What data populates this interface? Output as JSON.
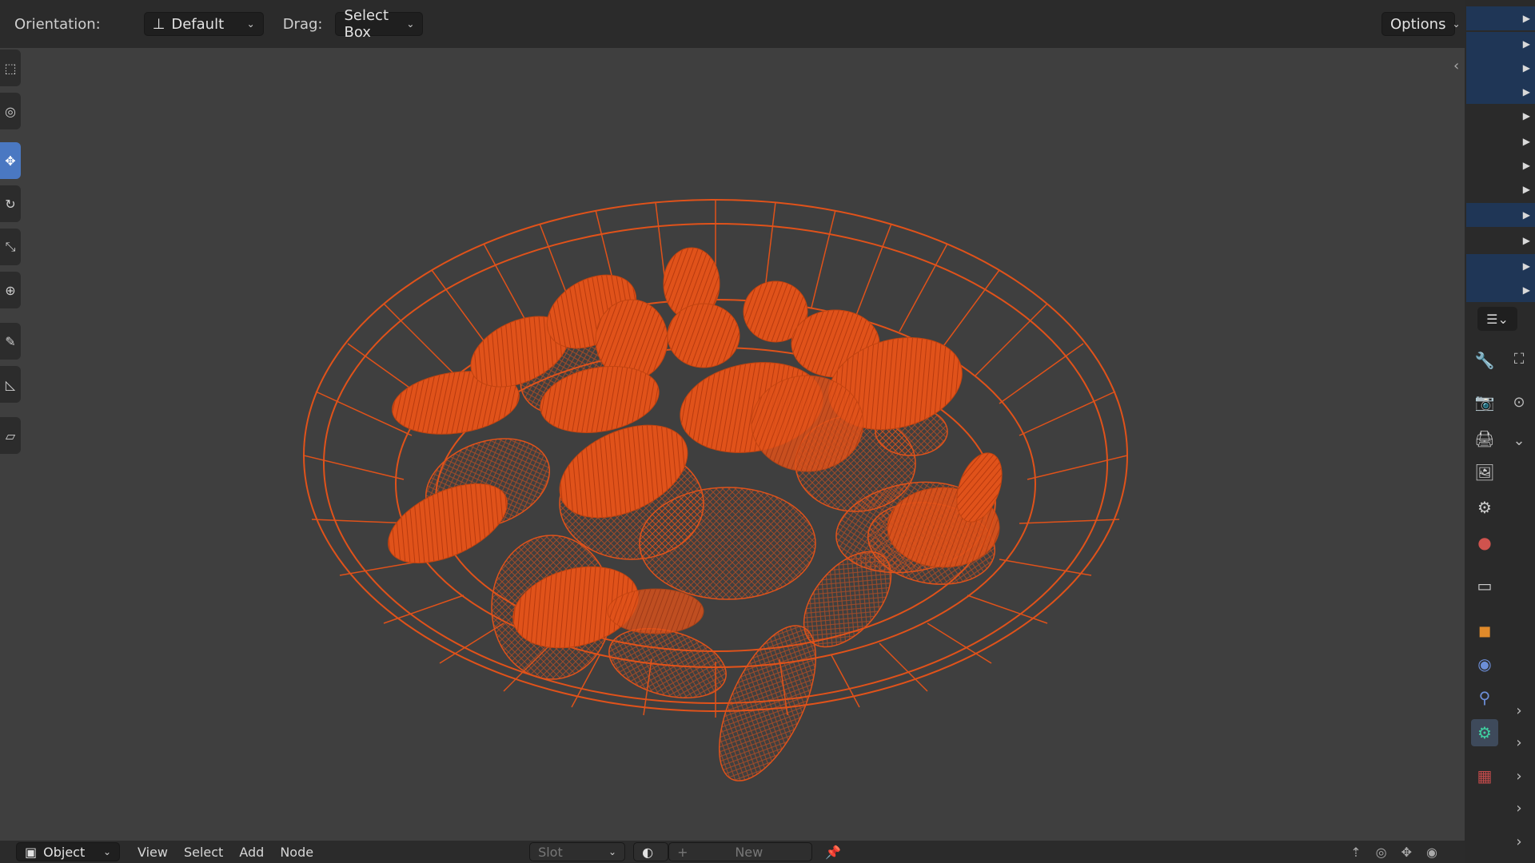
{
  "header": {
    "orientation_label": "Orientation:",
    "orientation_value": "Default",
    "drag_label": "Drag:",
    "drag_value": "Select Box",
    "options_label": "Options"
  },
  "toolbar": {
    "tools": [
      {
        "name": "select-box-tool-icon",
        "glyph": "⬚"
      },
      {
        "name": "cursor-tool-icon",
        "glyph": "◎"
      },
      {
        "name": "move-tool-icon",
        "glyph": "✥"
      },
      {
        "name": "rotate-tool-icon",
        "glyph": "↻"
      },
      {
        "name": "scale-tool-icon",
        "glyph": "⤡"
      },
      {
        "name": "transform-tool-icon",
        "glyph": "⊕"
      },
      {
        "name": "annotate-tool-icon",
        "glyph": "✎"
      },
      {
        "name": "measure-tool-icon",
        "glyph": "📐"
      },
      {
        "name": "add-cube-tool-icon",
        "glyph": "▱"
      }
    ]
  },
  "bottom": {
    "mode": "Object",
    "menus": [
      "View",
      "Select",
      "Add",
      "Node"
    ],
    "slot_label": "Slot",
    "new_label": "New"
  },
  "icons": {
    "tool_settings": "wrench-icon",
    "render": "render-icon",
    "output": "output-icon",
    "view_layer": "view-layer-icon",
    "scene": "scene-icon",
    "world": "world-icon",
    "collection": "collection-icon",
    "object": "object-icon",
    "modifiers": "modifiers-icon",
    "particles": "particles-icon",
    "physics": "physics-icon",
    "texture": "texture-icon"
  },
  "colors": {
    "wireframe": "#e0521a",
    "accent": "#4a78c2",
    "selected_row": "#1f3656"
  }
}
